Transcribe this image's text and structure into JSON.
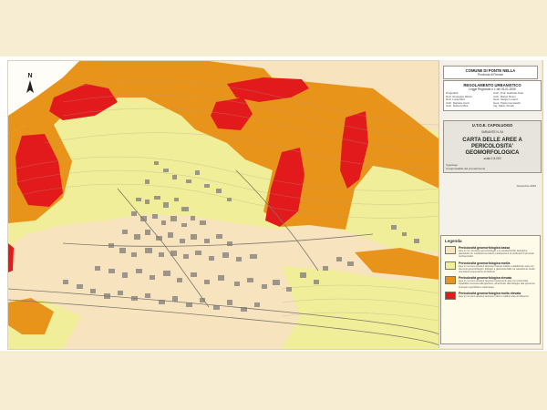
{
  "title_block": {
    "comune": "COMUNE DI PONTE NELLA",
    "provincia": "Provincia di Firenze",
    "regolamento": "REGOLAMENTO URBANISTICO",
    "regolamento_sub": "Legge Regionale n.1 del 03.01.2005",
    "progettisti_label": "Progettisti",
    "progettisti_lines": [
      "Arch. Prof. Gabriele Pasi",
      "Arch. Marco Rossi",
      "Geol. Sergio Lorenzi",
      "Geol. Paolo Ceccarelli",
      "Ing. Fabio Tonelli"
    ],
    "collaboratori_lines": [
      "Dott. Giuseppe Riccio",
      "Dott. Lucia Mori",
      "Arch. Daniela Conti",
      "Arch. Roberto Bini"
    ],
    "utoe": "U.T.O.E. CAPOLUOGO",
    "variante": "VARIANTE N. 54",
    "carta_title": "CARTA DELLE AREE A PERICOLOSITA' GEOMORFOLOGICA",
    "scala": "scala 1:5.000",
    "geologo": "Il geologo",
    "responsabile": "Il responsabile del procedimento",
    "date": "Novembre 2010"
  },
  "north_label": "N",
  "legend": {
    "title": "Legenda",
    "items": [
      {
        "label": "Pericolosità geomorfologica bassa",
        "desc": "aree in cui i processi geomorfologici e le caratteristiche litologiche giaciturali non costituiscono fattori predisponenti al verificarsi di processi morfoevolutivi",
        "color": "#f7e4bf"
      },
      {
        "label": "Pericolosità geomorfologica media",
        "desc": "aree in cui sono presenti fenomeni franosi inattivi e stabilizzati; aree con elementi geomorfologici, litologici e giaciturali dalla cui valutazione risulta una bassa propensione al dissesto",
        "color": "#f0ee98"
      },
      {
        "label": "Pericolosità geomorfologica elevata",
        "desc": "aree in cui sono presenti fenomeni quiescenti; aree con potenziale instabilità connessa alla giacitura, all'acclività, alla litologia, alla presenza di acque superficiali e sotterranee",
        "color": "#e8941a"
      },
      {
        "label": "Pericolosità geomorfologica molto elevata",
        "desc": "aree in cui sono presenti fenomeni attivi e relative aree di influenza",
        "color": "#e31a1c"
      }
    ]
  },
  "colors": {
    "low": "#f7e4bf",
    "medium": "#f0ee98",
    "high": "#e8941a",
    "very_high": "#e31a1c",
    "urban": "#9c9589"
  }
}
